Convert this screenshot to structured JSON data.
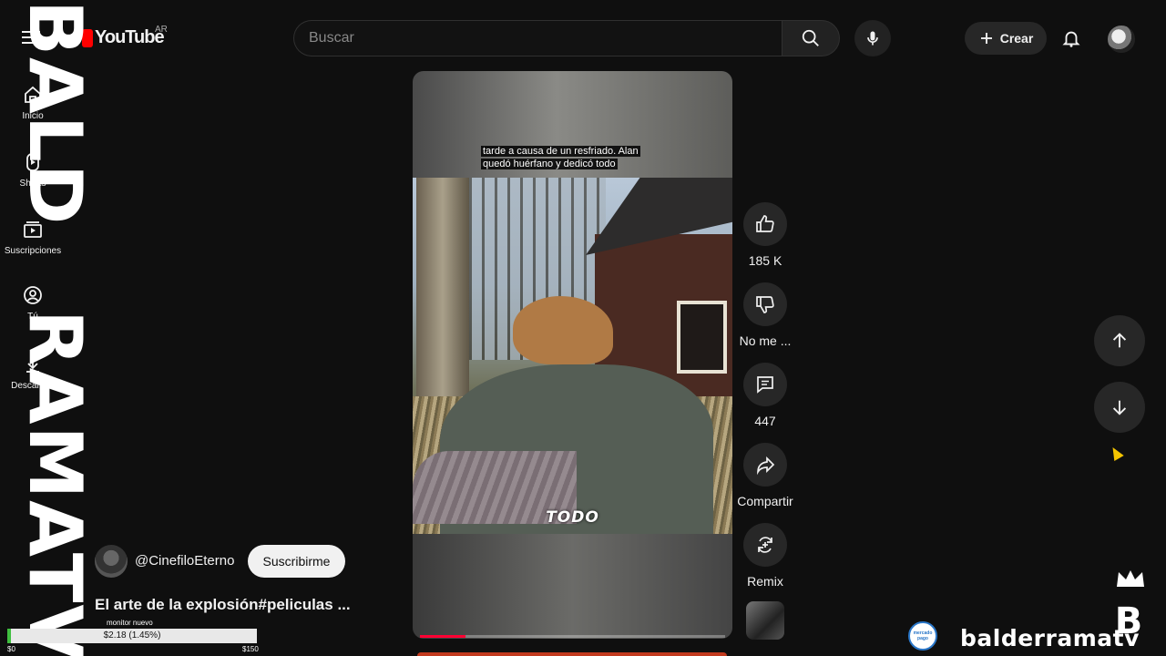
{
  "header": {
    "logo_text": "YouTube",
    "region": "AR",
    "search_placeholder": "Buscar",
    "create_label": "Crear"
  },
  "sidebar": {
    "items": [
      {
        "label": "Inicio",
        "icon": "home-icon"
      },
      {
        "label": "Shorts",
        "icon": "shorts-icon"
      },
      {
        "label": "Suscripciones",
        "icon": "subscriptions-icon"
      },
      {
        "label": "Tú",
        "icon": "user-circle-icon"
      },
      {
        "label": "Descargas",
        "icon": "download-icon"
      }
    ]
  },
  "overlay": {
    "watermark_top": "BALD",
    "watermark_bottom": "RAMATV",
    "handle": "balderramatv",
    "payment_badge": "mercado pago",
    "donation_label": "monitor nuevo",
    "donation_amount": "$2.18 (1.45%)",
    "donation_progress": 0.0145,
    "donation_min": "$0",
    "donation_max": "$150"
  },
  "video": {
    "caption_top_line1": "tarde a causa de un resfriado. Alan",
    "caption_top_line2": "quedó huérfano y dedicó todo",
    "caption_word": "TODO",
    "progress": 0.15
  },
  "actions": {
    "like_count": "185 K",
    "dislike_label": "No me ...",
    "comment_count": "447",
    "share_label": "Compartir",
    "remix_label": "Remix"
  },
  "channel": {
    "handle": "@CinefiloEterno",
    "subscribe_label": "Suscribirme",
    "video_title": "El arte de la explosión#peliculas ..."
  },
  "colors": {
    "background": "#0f0f0f",
    "accent": "#ff0000",
    "button": "#272727"
  }
}
